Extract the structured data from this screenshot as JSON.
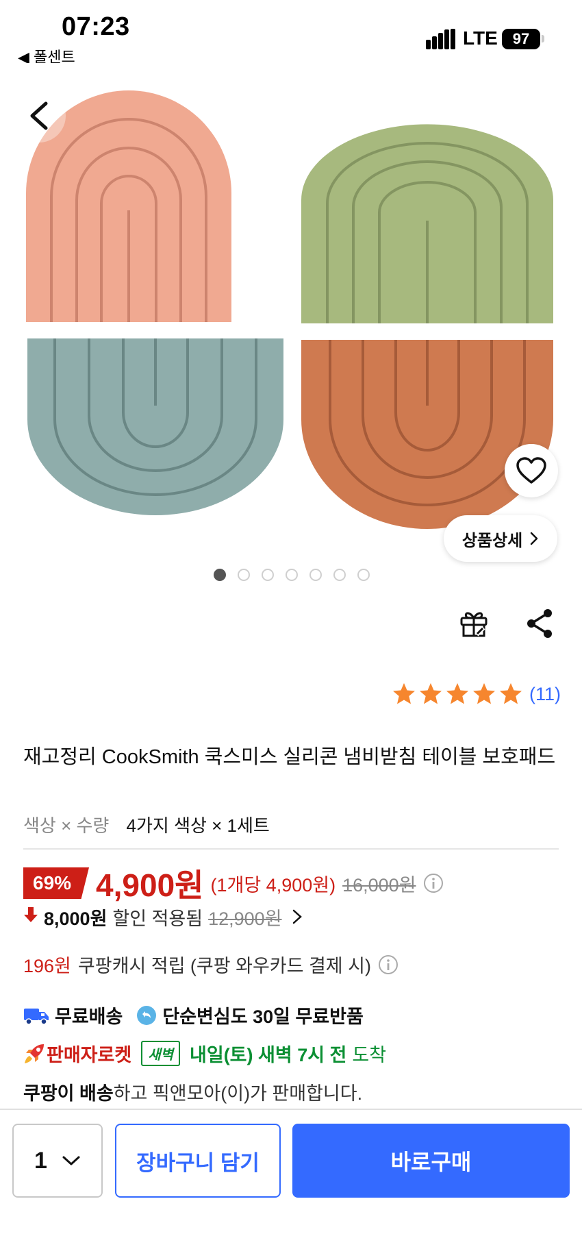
{
  "status_bar": {
    "time": "07:23",
    "back_app": "◀ 폴센트",
    "network": "LTE",
    "battery": "97"
  },
  "gallery": {
    "dots_total": 7,
    "active_index": 0,
    "detail_button_label": "상품상세",
    "colors": [
      "#f0a991",
      "#a7b97e",
      "#8fadab",
      "#cf7a50"
    ]
  },
  "rating": {
    "stars": 5,
    "count": "(11)"
  },
  "product": {
    "title": "재고정리 CookSmith 쿡스미스 실리콘 냄비받침 테이블 보호패드",
    "option_label": "색상 × 수량",
    "option_value": "4가지 색상 × 1세트"
  },
  "price": {
    "discount_rate": "69%",
    "sale_price": "4,900원",
    "unit_price": "(1개당 4,900원)",
    "original_price": "16,000원",
    "coupon_amount": "8,000원",
    "coupon_text": "할인 적용됨",
    "coupon_original": "12,900원"
  },
  "cash": {
    "amount": "196원",
    "text": "쿠팡캐시 적립 (쿠팡 와우카드 결제 시)"
  },
  "shipping": {
    "free_shipping": "무료배송",
    "free_return": "단순변심도 30일 무료반품"
  },
  "rocket": {
    "label": "판매자로켓",
    "badge": "새벽",
    "arrival_bold": "내일(토) 새벽 7시 전",
    "arrival_suffix": "도착"
  },
  "seller": {
    "bold": "쿠팡이 배송",
    "text": "하고 픽앤모아(이)가 판매합니다."
  },
  "bottom_bar": {
    "quantity": "1",
    "cart_label": "장바구니 담기",
    "buy_label": "바로구매"
  },
  "accent_colors": {
    "primary": "#346aff",
    "sale": "#cd1f17",
    "dawn": "#0b8f33"
  }
}
